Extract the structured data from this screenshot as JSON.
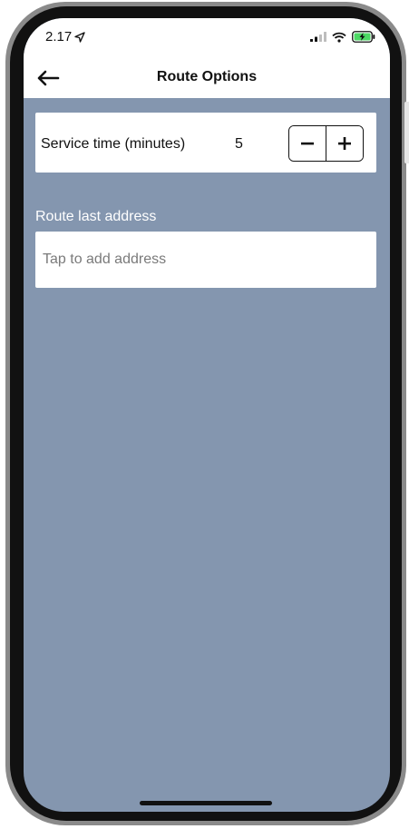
{
  "status_bar": {
    "time": "2.17",
    "icons": [
      "location-arrow-icon",
      "signal-icon",
      "wifi-icon",
      "battery-charging-icon"
    ]
  },
  "header": {
    "title": "Route Options",
    "back_icon": "back-arrow-icon"
  },
  "service_time": {
    "label": "Service time (minutes)",
    "value": "5",
    "decrement_icon": "minus-icon",
    "increment_icon": "plus-icon"
  },
  "route_last_address": {
    "label": "Route last address",
    "placeholder": "Tap to add address"
  },
  "colors": {
    "background": "#8496af",
    "header": "#ffffff",
    "battery": "#4cd964"
  }
}
